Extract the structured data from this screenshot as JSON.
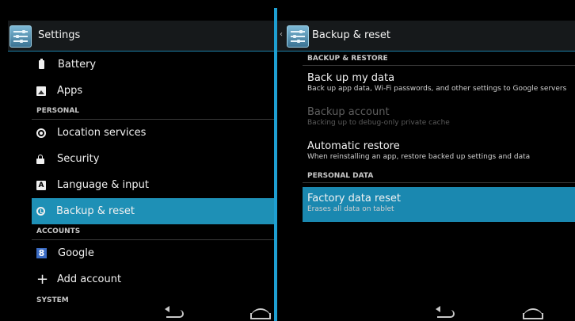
{
  "left": {
    "title": "Settings",
    "items": [
      {
        "type": "item",
        "label": "Battery",
        "icon": "battery-icon"
      },
      {
        "type": "item",
        "label": "Apps",
        "icon": "apps-icon"
      },
      {
        "type": "header",
        "label": "PERSONAL"
      },
      {
        "type": "item",
        "label": "Location services",
        "icon": "location-icon"
      },
      {
        "type": "item",
        "label": "Security",
        "icon": "lock-icon"
      },
      {
        "type": "item",
        "label": "Language & input",
        "icon": "language-icon"
      },
      {
        "type": "item",
        "label": "Backup & reset",
        "icon": "backup-icon",
        "selected": true
      },
      {
        "type": "header",
        "label": "ACCOUNTS"
      },
      {
        "type": "item",
        "label": "Google",
        "icon": "google-icon"
      },
      {
        "type": "item",
        "label": "Add account",
        "icon": "plus-icon"
      }
    ],
    "cut_header": "SYSTEM",
    "google_glyph": "8",
    "lang_glyph": "A",
    "plus_glyph": "+"
  },
  "right": {
    "title": "Backup & reset",
    "up_caret": "‹",
    "sections": {
      "backup_restore_header": "BACKUP & RESTORE",
      "personal_data_header": "PERSONAL DATA"
    },
    "backup_my_data": {
      "title": "Back up my data",
      "summary": "Back up app data, Wi-Fi passwords, and other settings to Google servers"
    },
    "backup_account": {
      "title": "Backup account",
      "summary": "Backing up to debug-only private cache"
    },
    "automatic_restore": {
      "title": "Automatic restore",
      "summary": "When reinstalling an app, restore backed up settings and data"
    },
    "factory_reset": {
      "title": "Factory data reset",
      "summary": "Erases all data on tablet"
    }
  },
  "colors": {
    "accent": "#1e90b6",
    "divider": "#1e9fd2",
    "background": "#000000"
  }
}
